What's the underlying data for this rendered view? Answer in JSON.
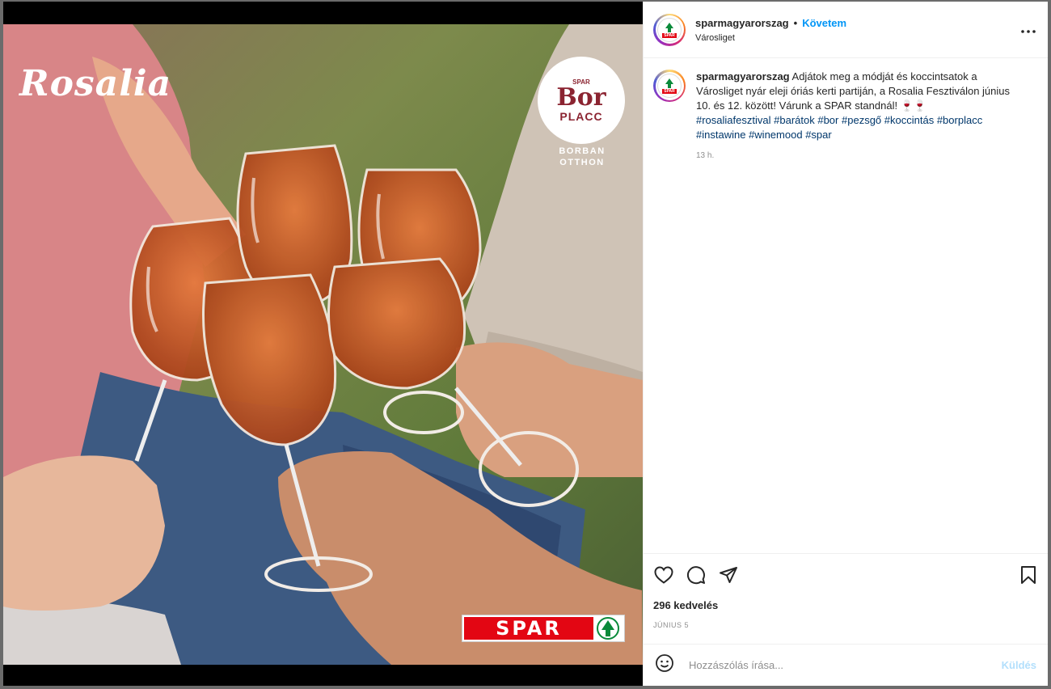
{
  "post": {
    "username": "sparmagyarorszag",
    "separator": "•",
    "follow_label": "Követem",
    "location": "Városliget",
    "more_label": "•••",
    "avatar_text": "SPAR"
  },
  "caption": {
    "username": "sparmagyarorszag",
    "text": "Adjátok meg a módját és koccintsatok a Városliget nyár eleji óriás kerti partiján, a Rosalia Fesztiválon június 10. és 12. között! Várunk a SPAR standnál! 🍷🍷",
    "hashtags": [
      "#rosaliafesztival",
      "#barátok",
      "#bor",
      "#pezsgő",
      "#koccintás",
      "#borplacc",
      "#instawine",
      "#winemood",
      "#spar"
    ],
    "time": "13 h."
  },
  "stats": {
    "likes": "296 kedvelés",
    "date": "JÚNIUS 5"
  },
  "comment_box": {
    "placeholder": "Hozzászólás írása...",
    "send_label": "Küldés"
  },
  "image": {
    "brand_left": "Rosalia",
    "badge_top": "SPAR",
    "badge_line1": "Bor",
    "badge_line2": "PLACC",
    "badge_sub1": "BORBAN",
    "badge_sub2": "OTTHON",
    "spar_logo": "SPAR"
  },
  "colors": {
    "accent": "#0095f6",
    "hashtag": "#00376b",
    "spar_red": "#e30613",
    "spar_green": "#0a8a3a",
    "wine": "#c8551e"
  }
}
